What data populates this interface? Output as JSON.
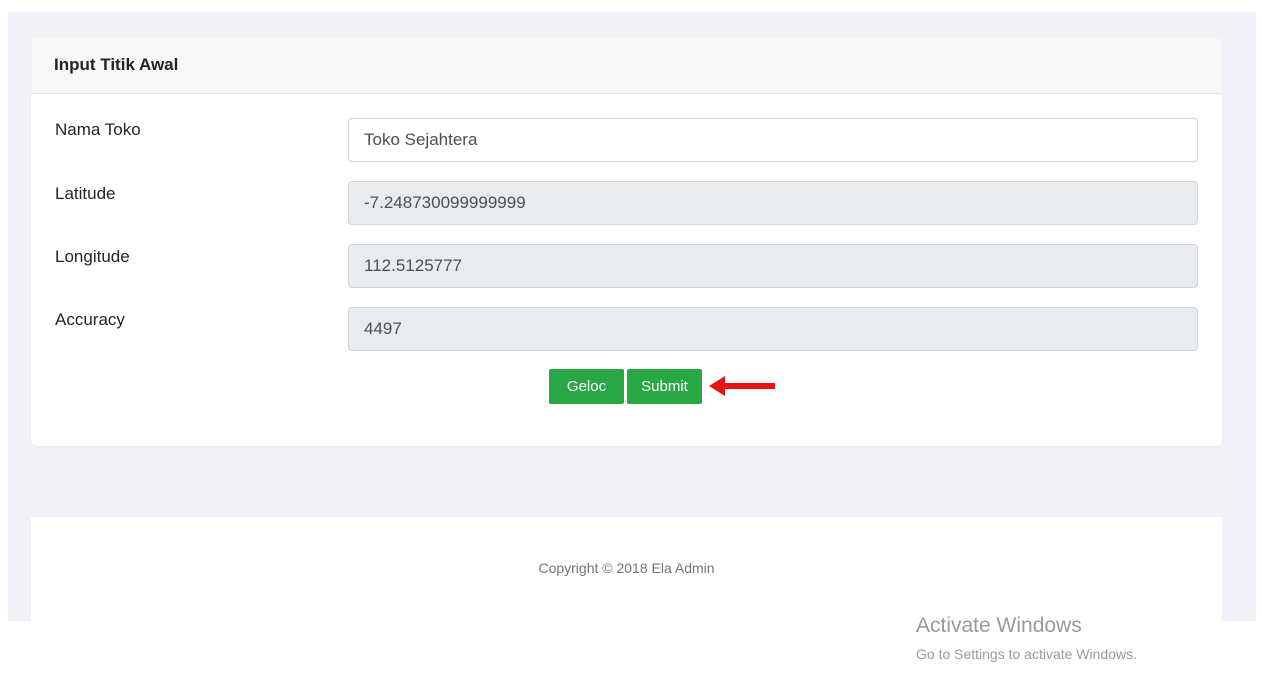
{
  "card": {
    "title": "Input Titik Awal"
  },
  "form": {
    "nama_toko": {
      "label": "Nama Toko",
      "value": "Toko Sejahtera"
    },
    "latitude": {
      "label": "Latitude",
      "value": "-7.248730099999999"
    },
    "longitude": {
      "label": "Longitude",
      "value": "112.5125777"
    },
    "accuracy": {
      "label": "Accuracy",
      "value": "4497"
    }
  },
  "buttons": {
    "geoloc_label": "Geloc",
    "submit_label": "Submit"
  },
  "footer": {
    "copyright": "Copyright © 2018 Ela Admin"
  },
  "watermark": {
    "title": "Activate Windows",
    "subtitle": "Go to Settings to activate Windows."
  },
  "colors": {
    "success": "#28a745",
    "annotation_arrow": "#e81414",
    "page_background": "#f1f2f7"
  },
  "icons": {
    "annotation": "left-arrow-icon"
  }
}
